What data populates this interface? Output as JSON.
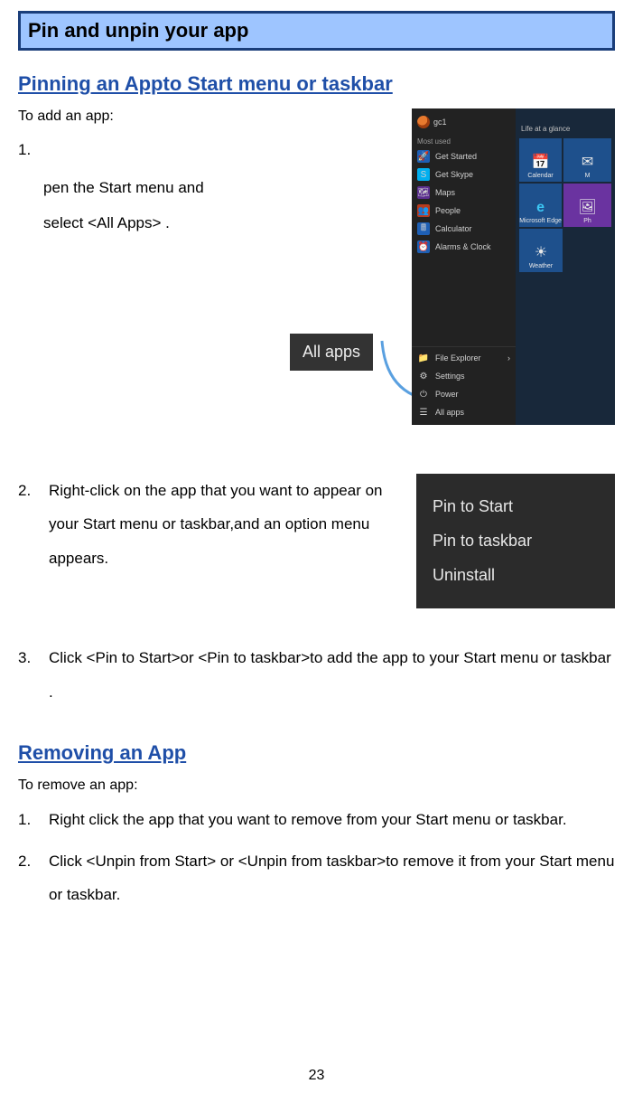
{
  "titleBar": "Pin and unpin your app",
  "section1": {
    "heading": "Pinning an Appto Start menu or taskbar",
    "intro": "To add an app:",
    "step1": {
      "num": "1.",
      "line1": "pen the Start menu and",
      "line2": "select <All Apps> ."
    },
    "step2": {
      "num": "2.",
      "text": "Right-click on the app that you want to appear on your Start menu or taskbar,and an option menu appears."
    },
    "step3": {
      "num": "3.",
      "text": "Click <Pin to Start>or <Pin to taskbar>to add the app to your Start menu or taskbar ."
    }
  },
  "section2": {
    "heading": "Removing an App",
    "intro": "To remove an app:",
    "step1": {
      "num": "1.",
      "text": "Right click the app that you want to remove from your Start menu or taskbar."
    },
    "step2": {
      "num": "2.",
      "text": "Click <Unpin from Start> or <Unpin from taskbar>to remove it from your Start menu or taskbar."
    }
  },
  "startMenu": {
    "user": "gc1",
    "mostUsed": "Most used",
    "items": {
      "getStarted": "Get Started",
      "getSkype": "Get Skype",
      "maps": "Maps",
      "people": "People",
      "calculator": "Calculator",
      "alarms": "Alarms & Clock"
    },
    "bottom": {
      "fileExplorer": "File Explorer",
      "settings": "Settings",
      "power": "Power",
      "allApps": "All apps"
    },
    "glance": "Life at a glance",
    "tiles": {
      "calendar": "Calendar",
      "edge": "Microsoft Edge",
      "photos": "Ph",
      "weather": "Weather",
      "mail": "M"
    },
    "allAppsCallout": "All apps"
  },
  "contextMenu": {
    "pinStart": "Pin to Start",
    "pinTaskbar": "Pin to taskbar",
    "uninstall": "Uninstall"
  },
  "pageNumber": "23"
}
